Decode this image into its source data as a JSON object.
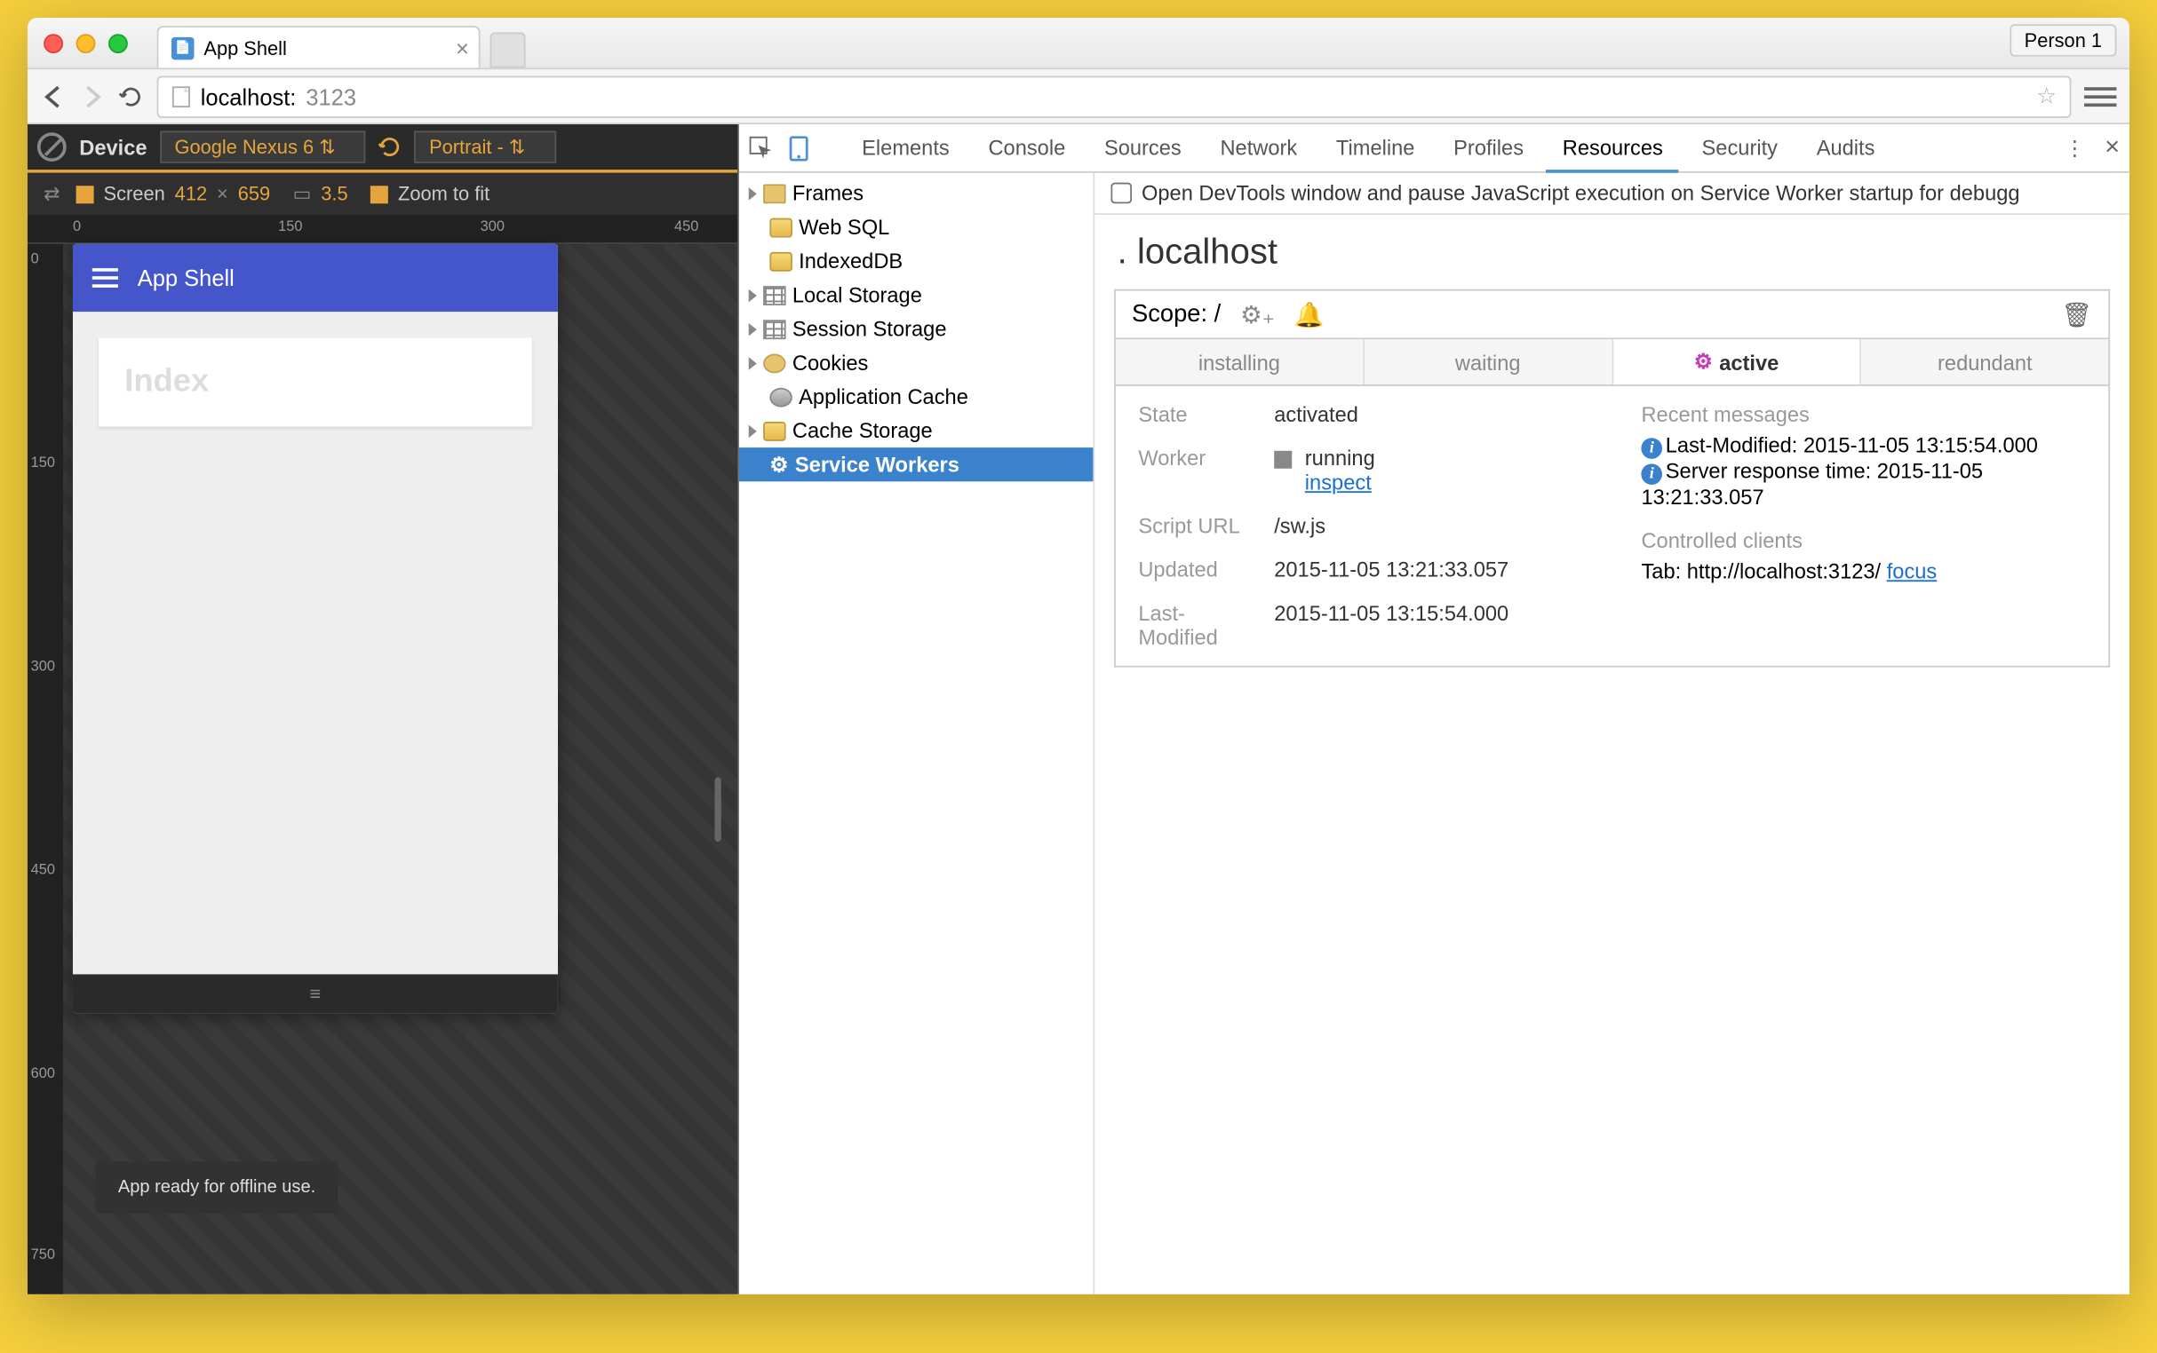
{
  "browser": {
    "tab_title": "App Shell",
    "person": "Person 1",
    "url_host": "localhost:",
    "url_port": "3123"
  },
  "device_toolbar": {
    "label": "Device",
    "device": "Google Nexus 6",
    "orientation": "Portrait ‑",
    "screen_label": "Screen",
    "width": "412",
    "times": "×",
    "height": "659",
    "dpr": "3.5",
    "zoom": "Zoom to fit",
    "ruler_h": [
      "0",
      "150",
      "300",
      "450"
    ],
    "ruler_v": [
      "0",
      "150",
      "300",
      "450",
      "600",
      "750"
    ]
  },
  "app": {
    "title": "App Shell",
    "card": "Index",
    "toast": "App ready for offline use."
  },
  "devtools": {
    "tabs": [
      "Elements",
      "Console",
      "Sources",
      "Network",
      "Timeline",
      "Profiles",
      "Resources",
      "Security",
      "Audits"
    ],
    "active_tab": "Resources",
    "tree": [
      {
        "label": "Frames",
        "icon": "folder",
        "arrow": true
      },
      {
        "label": "Web SQL",
        "icon": "db",
        "arrow": false
      },
      {
        "label": "IndexedDB",
        "icon": "db",
        "arrow": false
      },
      {
        "label": "Local Storage",
        "icon": "grid",
        "arrow": true
      },
      {
        "label": "Session Storage",
        "icon": "grid",
        "arrow": true
      },
      {
        "label": "Cookies",
        "icon": "cookie",
        "arrow": true
      },
      {
        "label": "Application Cache",
        "icon": "disk",
        "arrow": false
      },
      {
        "label": "Cache Storage",
        "icon": "db",
        "arrow": true
      },
      {
        "label": "Service Workers",
        "icon": "gear",
        "arrow": false,
        "selected": true
      }
    ],
    "sw": {
      "checkbox_label": "Open DevTools window and pause JavaScript execution on Service Worker startup for debugg",
      "host": "localhost",
      "scope_label": "Scope: /",
      "lifecycle": [
        "installing",
        "waiting",
        "active",
        "redundant"
      ],
      "lifecycle_active": "active",
      "state_label": "State",
      "state_value": "activated",
      "worker_label": "Worker",
      "worker_status": "running",
      "worker_inspect": "inspect",
      "script_label": "Script URL",
      "script_value": "/sw.js",
      "updated_label": "Updated",
      "updated_value": "2015-11-05 13:21:33.057",
      "modified_label": "Last-Modified",
      "modified_value": "2015-11-05 13:15:54.000",
      "recent_title": "Recent messages",
      "msg1": "Last-Modified: 2015-11-05 13:15:54.000",
      "msg2": "Server response time: 2015-11-05 13:21:33.057",
      "clients_title": "Controlled clients",
      "client_prefix": "Tab: http://localhost:3123/ ",
      "client_focus": "focus"
    }
  }
}
